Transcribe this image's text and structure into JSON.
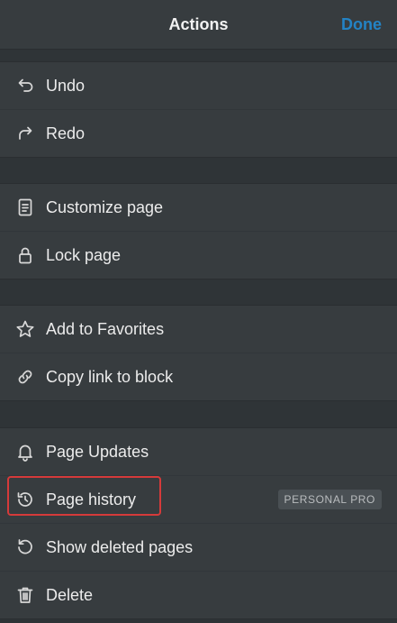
{
  "header": {
    "title": "Actions",
    "done_label": "Done"
  },
  "groups": [
    {
      "items": [
        {
          "label": "Undo",
          "icon": "undo-icon"
        },
        {
          "label": "Redo",
          "icon": "redo-icon"
        }
      ]
    },
    {
      "items": [
        {
          "label": "Customize page",
          "icon": "document-icon"
        },
        {
          "label": "Lock page",
          "icon": "lock-icon"
        }
      ]
    },
    {
      "items": [
        {
          "label": "Add to Favorites",
          "icon": "star-icon"
        },
        {
          "label": "Copy link to block",
          "icon": "link-icon"
        }
      ]
    },
    {
      "items": [
        {
          "label": "Page Updates",
          "icon": "bell-icon"
        },
        {
          "label": "Page history",
          "icon": "history-icon",
          "badge": "PERSONAL PRO"
        },
        {
          "label": "Show deleted pages",
          "icon": "restore-icon"
        },
        {
          "label": "Delete",
          "icon": "trash-icon"
        }
      ]
    }
  ],
  "colors": {
    "background": "#2f3437",
    "surface": "#373c3f",
    "accent": "#2383c5",
    "highlight": "#d53a3a"
  }
}
